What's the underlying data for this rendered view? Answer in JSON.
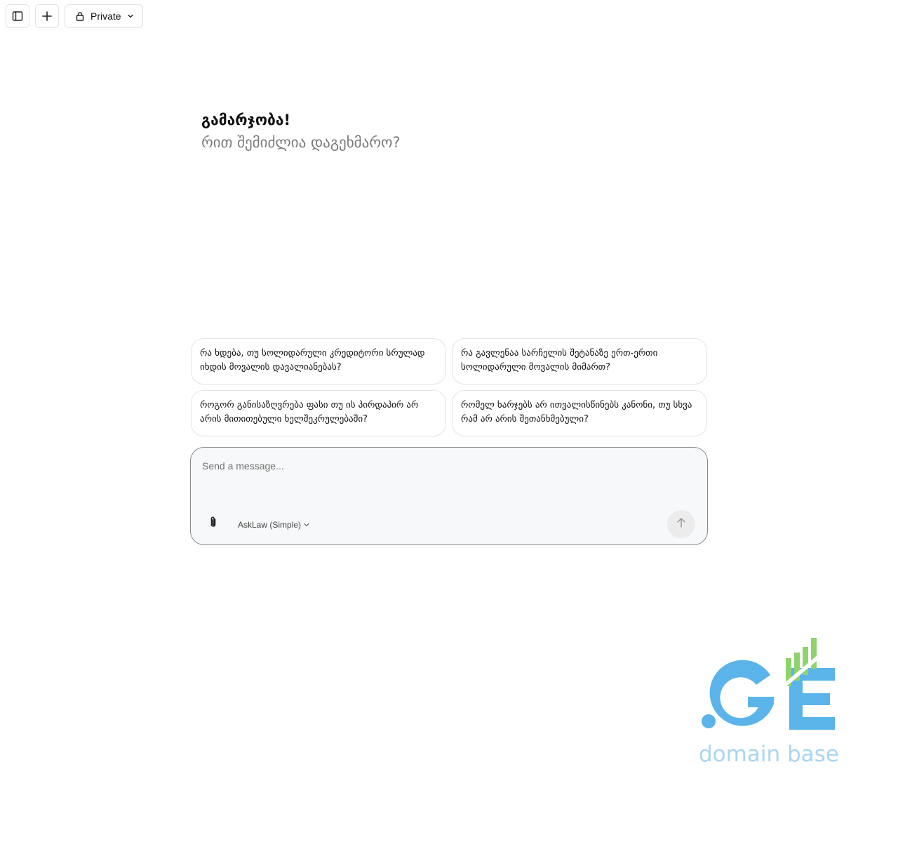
{
  "toolbar": {
    "sidebar_toggle_icon": "sidebar-toggle-icon",
    "new_chat_icon": "plus-icon",
    "visibility": {
      "label": "Private",
      "icon": "lock-icon",
      "chevron": "chevron-down-icon"
    }
  },
  "greeting": {
    "title": "გამარჯობა!",
    "subtitle": "რით შემიძლია დაგეხმარო?"
  },
  "suggestions": [
    {
      "text": "რა ხდება, თუ სოლიდარული კრედიტორი სრულად იხდის მოვალის დავალიანებას?"
    },
    {
      "text": "რა გავლენაა სარჩელის შეტანაზე ერთ-ერთი სოლიდარული მოვალის მიმართ?"
    },
    {
      "text": "როგორ განისაზღვრება ფასი თუ ის პირდაპირ არ არის მითითებული ხელშეკრულებაში?"
    },
    {
      "text": "რომელ ხარჯებს არ ითვალისწინებს კანონი, თუ სხვა რამ არ არის შეთანხმებული?"
    }
  ],
  "composer": {
    "placeholder": "Send a message...",
    "value": "",
    "attach_icon": "paperclip-icon",
    "model_label": "AskLaw (Simple)",
    "send_icon": "arrow-up-icon"
  },
  "logo": {
    "wordmark": ".GE",
    "tagline": "domain base",
    "colors": {
      "blue": "#5ab4ea",
      "green": "#8ed36b",
      "tagline": "#a9d6f2"
    }
  }
}
